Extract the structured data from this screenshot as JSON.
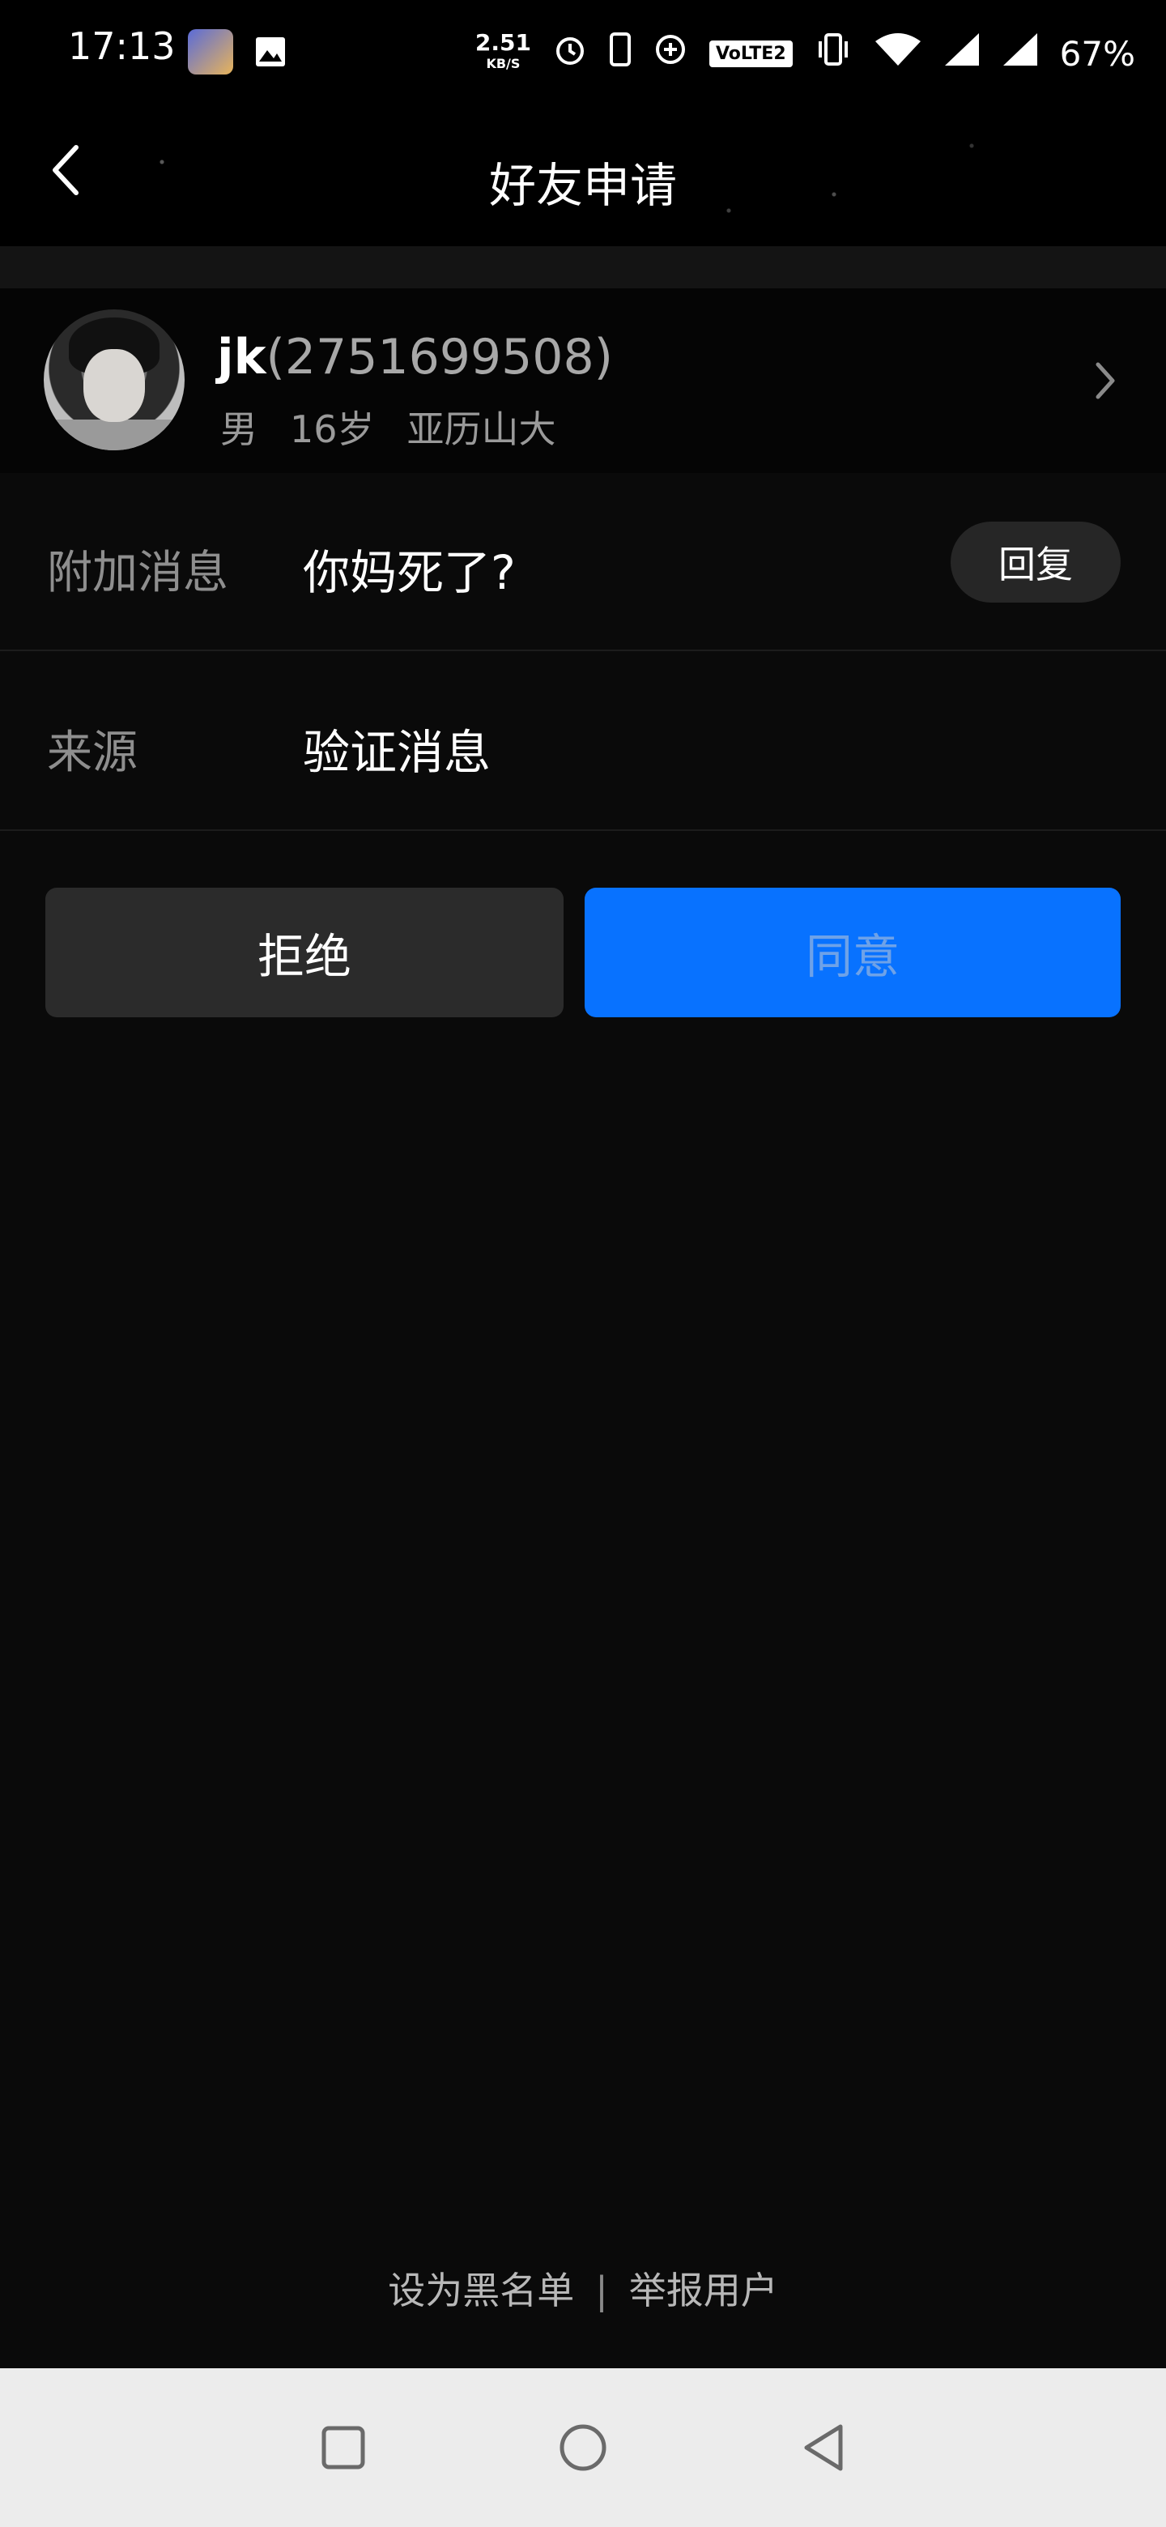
{
  "status_bar": {
    "time": "17:13",
    "net_speed": "2.51",
    "net_unit": "KB/S",
    "volte": "VoLTE2",
    "battery": "67%"
  },
  "nav": {
    "title": "好友申请"
  },
  "profile": {
    "nickname": "jk",
    "qq_number": "(2751699508)",
    "gender": "男",
    "age": "16岁",
    "location": "亚历山大"
  },
  "message_row": {
    "label": "附加消息",
    "value": "你妈死了?",
    "reply_label": "回复"
  },
  "source_row": {
    "label": "来源",
    "value": "验证消息"
  },
  "actions": {
    "reject_label": "拒绝",
    "accept_label": "同意"
  },
  "footer": {
    "blacklist_label": "设为黑名单",
    "separator": "|",
    "report_label": "举报用户"
  },
  "colors": {
    "accent": "#0872ff",
    "background": "#0a0a0a"
  }
}
